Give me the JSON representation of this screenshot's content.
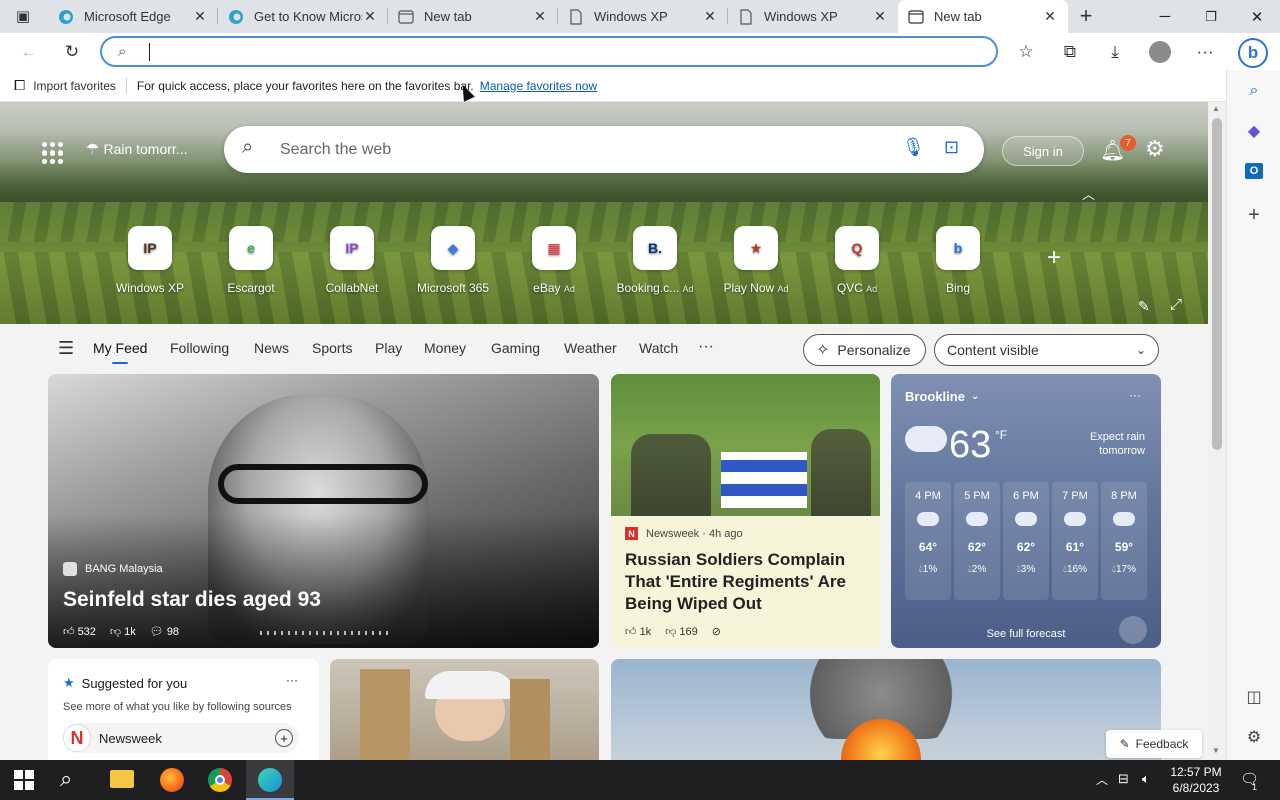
{
  "tabs": [
    {
      "title": "Microsoft Edge",
      "icon": "edge-icon"
    },
    {
      "title": "Get to Know Microsoft",
      "icon": "edge-icon"
    },
    {
      "title": "New tab",
      "icon": "newtab-icon"
    },
    {
      "title": "Windows XP",
      "icon": "page-icon"
    },
    {
      "title": "Windows XP",
      "icon": "page-icon"
    },
    {
      "title": "New tab",
      "icon": "newtab-icon",
      "active": true
    }
  ],
  "favbar": {
    "import": "Import favorites",
    "hint": "For quick access, place your favorites here on the favorites bar.",
    "manage": "Manage favorites now"
  },
  "hero": {
    "weather": "Rain tomorr...",
    "search_placeholder": "Search the web",
    "sign_in": "Sign in",
    "notif_count": "7"
  },
  "quicklinks": [
    {
      "label": "Windows XP",
      "ad": "",
      "glyph": "IP",
      "color": "#4a3a1c"
    },
    {
      "label": "Escargot",
      "ad": "",
      "glyph": "e",
      "color": "#3cb043"
    },
    {
      "label": "CollabNet",
      "ad": "",
      "glyph": "IP",
      "color": "#8a4fc7"
    },
    {
      "label": "Microsoft 365",
      "ad": "",
      "glyph": "◆",
      "color": "#3f7be0"
    },
    {
      "label": "eBay",
      "ad": "Ad",
      "glyph": "▦",
      "color": "#e53238"
    },
    {
      "label": "Booking.c...",
      "ad": "Ad",
      "glyph": "B.",
      "color": "#003580"
    },
    {
      "label": "Play Now",
      "ad": "Ad",
      "glyph": "★",
      "color": "#b5401e"
    },
    {
      "label": "QVC",
      "ad": "Ad",
      "glyph": "Q",
      "color": "#c53232"
    },
    {
      "label": "Bing",
      "ad": "",
      "glyph": "b",
      "color": "#1a73e8"
    }
  ],
  "feednav": {
    "items": [
      "My Feed",
      "Following",
      "News",
      "Sports",
      "Play",
      "Money",
      "Gaming",
      "Weather",
      "Watch"
    ],
    "more": "···",
    "personalize": "Personalize",
    "content": "Content visible"
  },
  "cards": {
    "main": {
      "source": "BANG Malaysia",
      "headline": "Seinfeld star dies aged 93",
      "likes": "532",
      "dislikes": "1k",
      "comments": "98"
    },
    "news2": {
      "source": "Newsweek · 4h ago",
      "headline": "Russian Soldiers Complain That 'Entire Regiments' Are Being Wiped Out",
      "likes": "1k",
      "dislikes": "169"
    },
    "weather": {
      "city": "Brookline",
      "temp": "63",
      "unit": "°F",
      "alert": "Expect rain tomorrow",
      "forecast_link": "See full forecast",
      "hours": [
        {
          "time": "4 PM",
          "temp": "64°",
          "rain": "1%"
        },
        {
          "time": "5 PM",
          "temp": "62°",
          "rain": "2%"
        },
        {
          "time": "6 PM",
          "temp": "62°",
          "rain": "3%"
        },
        {
          "time": "7 PM",
          "temp": "61°",
          "rain": "16%"
        },
        {
          "time": "8 PM",
          "temp": "59°",
          "rain": "17%"
        }
      ]
    },
    "suggested": {
      "title": "Suggested for you",
      "desc": "See more of what you like by following sources",
      "source": "Newsweek"
    }
  },
  "feedback": "Feedback",
  "taskbar": {
    "time": "12:57 PM",
    "date": "6/8/2023",
    "notif": "1"
  }
}
